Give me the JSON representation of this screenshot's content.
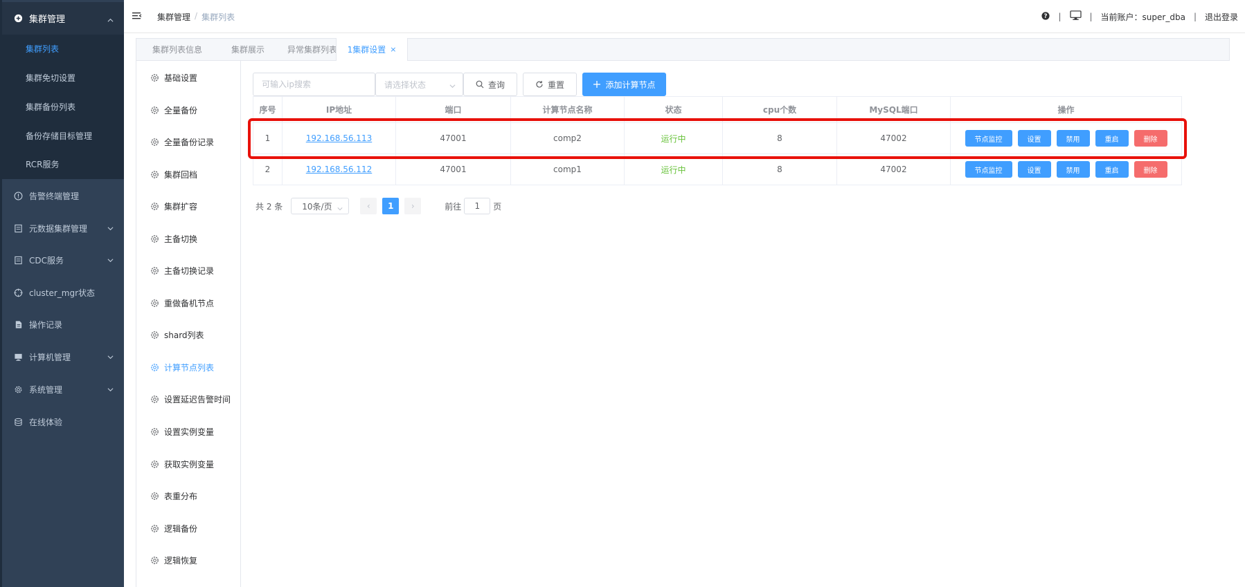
{
  "sidebar": {
    "group_title": "集群管理",
    "sub_items": [
      "集群列表",
      "集群免切设置",
      "集群备份列表",
      "备份存储目标管理",
      "RCR服务"
    ],
    "items": [
      {
        "label": "告警终端管理",
        "icon": "alert-circle-icon",
        "has_children": false
      },
      {
        "label": "元数据集群管理",
        "icon": "document-icon",
        "has_children": true
      },
      {
        "label": "CDC服务",
        "icon": "document-icon",
        "has_children": true
      },
      {
        "label": "cluster_mgr状态",
        "icon": "crosshair-icon",
        "has_children": false
      },
      {
        "label": "操作记录",
        "icon": "file-icon",
        "has_children": false
      },
      {
        "label": "计算机管理",
        "icon": "monitor-icon",
        "has_children": true
      },
      {
        "label": "系统管理",
        "icon": "gear-icon",
        "has_children": true
      },
      {
        "label": "在线体验",
        "icon": "database-icon",
        "has_children": false
      }
    ]
  },
  "header": {
    "breadcrumb_root": "集群管理",
    "breadcrumb_sep": "/",
    "breadcrumb_current": "集群列表",
    "account_text": "当前账户：super_dba",
    "logout": "退出登录",
    "separator": "|"
  },
  "tabs": [
    {
      "label": "集群列表信息",
      "active": false
    },
    {
      "label": "集群展示",
      "active": false
    },
    {
      "label": "异常集群列表",
      "active": false
    },
    {
      "label": "1集群设置",
      "active": true
    }
  ],
  "tab_close": "×",
  "settings_nav": [
    "基础设置",
    "全量备份",
    "全量备份记录",
    "集群回档",
    "集群扩容",
    "主备切换",
    "主备切换记录",
    "重做备机节点",
    "shard列表",
    "计算节点列表",
    "设置延迟告警时间",
    "设置实例变量",
    "获取实例变量",
    "表重分布",
    "逻辑备份",
    "逻辑恢复"
  ],
  "toolbar": {
    "search_placeholder": "可输入ip搜索",
    "status_placeholder": "请选择状态",
    "query_label": "查询",
    "reset_label": "重置",
    "add_label": "添加计算节点"
  },
  "table": {
    "columns": [
      "序号",
      "IP地址",
      "端口",
      "计算节点名称",
      "状态",
      "cpu个数",
      "MySQL端口",
      "操作"
    ],
    "rows": [
      {
        "index": "1",
        "ip": "192.168.56.113",
        "port": "47001",
        "name": "comp2",
        "status": "运行中",
        "cpu": "8",
        "mysql_port": "47002"
      },
      {
        "index": "2",
        "ip": "192.168.56.112",
        "port": "47001",
        "name": "comp1",
        "status": "运行中",
        "cpu": "8",
        "mysql_port": "47002"
      }
    ],
    "actions": {
      "monitor": "节点监控",
      "settings": "设置",
      "disable": "禁用",
      "restart": "重启",
      "delete": "删除"
    }
  },
  "pagination": {
    "total": "共 2 条",
    "page_size": "10条/页",
    "current_page": "1",
    "goto_prefix": "前往",
    "goto_value": "1",
    "goto_suffix": "页",
    "prev": "‹",
    "next": "›"
  },
  "colors": {
    "sidebar_bg": "#304156",
    "primary": "#409eff",
    "danger": "#f56c6c",
    "success": "#67c23a",
    "highlight_box": "#e8110b"
  }
}
